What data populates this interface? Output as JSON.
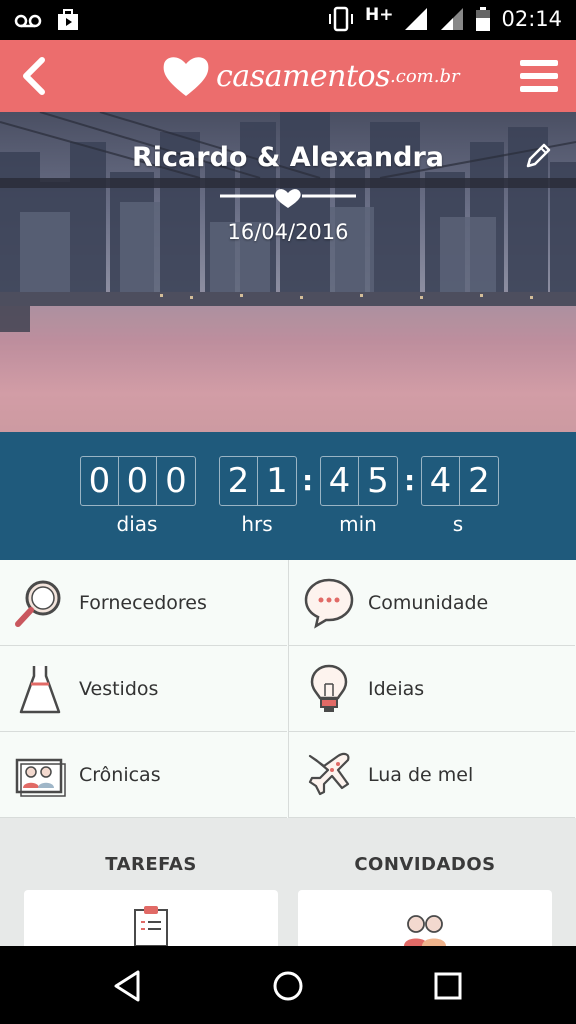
{
  "status_bar": {
    "time": "02:14",
    "network": "H+",
    "icons": [
      "voicemail-icon",
      "shop-bag-icon",
      "vibrate-icon",
      "signal-icon",
      "battery-icon"
    ]
  },
  "app_bar": {
    "logo_text": "casamentos",
    "logo_domain": ".com.br",
    "back_icon": "chevron-left-icon",
    "menu_icon": "hamburger-icon",
    "color": "#ec6d6d"
  },
  "hero": {
    "couple": "Ricardo & Alexandra",
    "date": "16/04/2016",
    "edit_icon": "pencil-icon"
  },
  "countdown": {
    "days": [
      "0",
      "0",
      "0"
    ],
    "hours": [
      "2",
      "1"
    ],
    "minutes": [
      "4",
      "5"
    ],
    "seconds": [
      "4",
      "2"
    ],
    "labels": {
      "days": "dias",
      "hours": "hrs",
      "minutes": "min",
      "seconds": "s"
    },
    "color": "#1f5a7c"
  },
  "menu": {
    "items": [
      {
        "label": "Fornecedores",
        "icon": "magnifier-icon"
      },
      {
        "label": "Comunidade",
        "icon": "chat-bubble-icon"
      },
      {
        "label": "Vestidos",
        "icon": "dress-icon"
      },
      {
        "label": "Ideias",
        "icon": "lightbulb-icon"
      },
      {
        "label": "Crônicas",
        "icon": "photo-couple-icon"
      },
      {
        "label": "Lua de mel",
        "icon": "airplane-icon"
      }
    ]
  },
  "sections": {
    "tasks": "TAREFAS",
    "guests": "CONVIDADOS"
  }
}
